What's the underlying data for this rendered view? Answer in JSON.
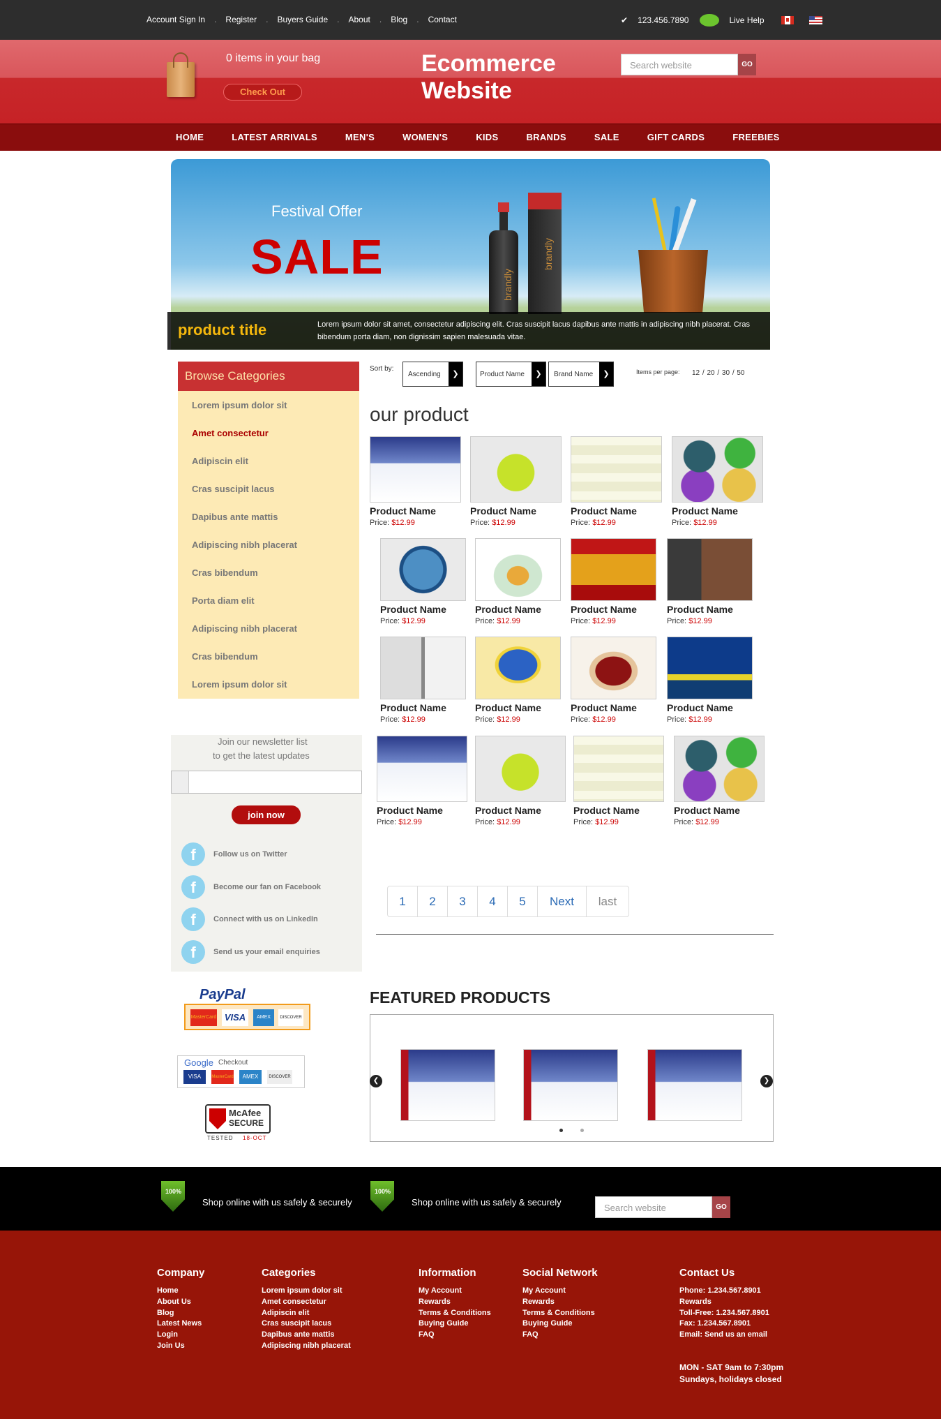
{
  "topbar": {
    "links": [
      "Account Sign In",
      "Register",
      "Buyers Guide",
      "About",
      "Blog",
      "Contact"
    ],
    "phone": "123.456.7890",
    "live_help": "Live Help"
  },
  "header": {
    "bag_text": "0 items in your bag",
    "checkout": "Check Out",
    "site_title_1": "Ecommerce",
    "site_title_2": "Website",
    "search_placeholder": "Search website",
    "go": "GO"
  },
  "mainnav": [
    "HOME",
    "LATEST ARRIVALS",
    "MEN'S",
    "WOMEN'S",
    "KIDS",
    "BRANDS",
    "SALE",
    "GIFT CARDS",
    "FREEBIES"
  ],
  "banner": {
    "festival": "Festival Offer",
    "sale": "SALE",
    "brand_1": "brandly",
    "brand_2": "brandly",
    "product_title": "product title",
    "desc": "Lorem ipsum dolor sit amet, consectetur adipiscing elit. Cras suscipit lacus dapibus ante mattis in adipiscing nibh placerat. Cras bibendum porta diam, non dignissim sapien malesuada vitae."
  },
  "categories": {
    "title": "Browse Categories",
    "items": [
      "Lorem ipsum dolor sit",
      "Amet consectetur",
      "Adipiscin elit",
      "Cras suscipit lacus",
      "Dapibus ante mattis",
      "Adipiscing nibh placerat",
      "Cras bibendum",
      "Porta diam elit",
      "Adipiscing nibh placerat",
      "Cras bibendum",
      "Lorem ipsum dolor sit"
    ]
  },
  "sort": {
    "label": "Sort by:",
    "ascending": "Ascending",
    "product_name": "Product Name",
    "brand_name": "Brand Name",
    "per_page_label": "Items per page:",
    "per_page": "12 / 20 / 30 / 50"
  },
  "products": {
    "heading": "our product",
    "name": "Product Name",
    "price_label": "Price:",
    "price": "$12.99"
  },
  "newsletter": {
    "line1": "Join our newsletter list",
    "line2": "to get the latest updates",
    "join": "join now",
    "social": [
      "Follow us on Twitter",
      "Become our fan on Facebook",
      "Connect with us on LinkedIn",
      "Send us your email enquiries"
    ]
  },
  "payment": {
    "paypal": "PayPal",
    "google": "Google",
    "checkout": "Checkout",
    "visa": "VISA",
    "mastercard": "MasterCard",
    "amex": "AMEX",
    "discover": "DISCOVER",
    "mcafee": "McAfee",
    "secure": "SECURE",
    "tested": "TESTED",
    "date": "18-OCT"
  },
  "pager": [
    "1",
    "2",
    "3",
    "4",
    "5",
    "Next",
    "last"
  ],
  "featured": {
    "heading": "FEATURED PRODUCTS"
  },
  "secure_band": {
    "text": "Shop online with us safely & securely",
    "badge": "100%",
    "search_placeholder": "Search website",
    "go": "GO"
  },
  "footer": {
    "company": {
      "title": "Company",
      "items": [
        "Home",
        "About Us",
        "Blog",
        "Latest News",
        "Login",
        "Join Us"
      ]
    },
    "categories": {
      "title": "Categories",
      "items": [
        "Lorem ipsum dolor sit",
        "Amet consectetur",
        "Adipiscin elit",
        "Cras suscipit lacus",
        "Dapibus ante mattis",
        "Adipiscing nibh placerat"
      ]
    },
    "information": {
      "title": "Information",
      "items": [
        "My Account",
        "Rewards",
        "Terms & Conditions",
        "Buying Guide",
        "FAQ"
      ]
    },
    "social": {
      "title": "Social Network",
      "items": [
        "My Account",
        "Rewards",
        "Terms & Conditions",
        "Buying Guide",
        "FAQ"
      ]
    },
    "contact": {
      "title": "Contact Us",
      "items": [
        "Phone: 1.234.567.8901",
        "Rewards",
        "Toll-Free: 1.234.567.8901",
        "Fax: 1.234.567.8901",
        "Email: Send us an email"
      ],
      "hours1": "MON - SAT 9am to 7:30pm",
      "hours2": "Sundays, holidays closed"
    }
  },
  "colors": {
    "accent": "#c62226",
    "nav": "#8a0d0d",
    "footer": "#971508"
  }
}
